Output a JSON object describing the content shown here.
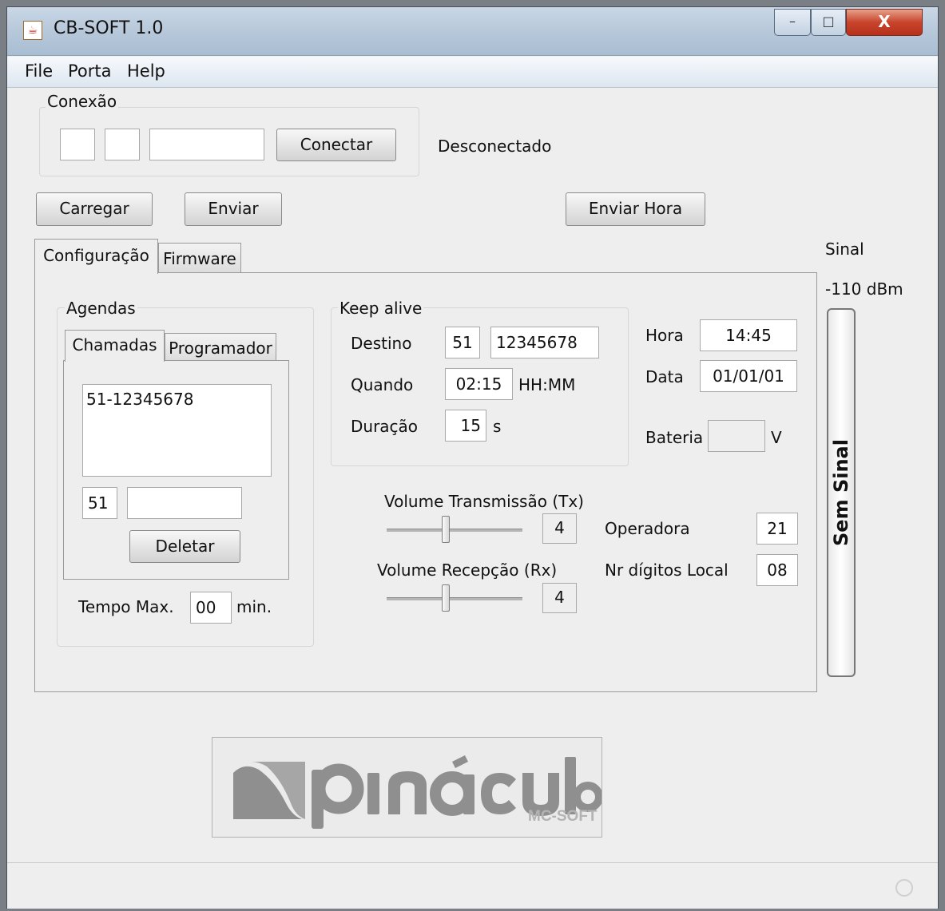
{
  "window": {
    "title": "CB-SOFT 1.0",
    "minimize": "–",
    "maximize": "□",
    "close": "X"
  },
  "menu": {
    "file": "File",
    "porta": "Porta",
    "help": "Help"
  },
  "conexao": {
    "label": "Conexão",
    "field1": "",
    "field2": "",
    "field3": "",
    "connect_button": "Conectar",
    "status": "Desconectado"
  },
  "toolbar": {
    "carregar": "Carregar",
    "enviar": "Enviar",
    "enviar_hora": "Enviar Hora"
  },
  "tabs": {
    "configuracao": "Configuração",
    "firmware": "Firmware"
  },
  "agendas": {
    "label": "Agendas",
    "tab_chamadas": "Chamadas",
    "tab_programador": "Programador",
    "list_items": [
      "51-12345678"
    ],
    "ddd": "51",
    "number": "",
    "delete_button": "Deletar",
    "tempo_max_label": "Tempo Max.",
    "tempo_max_value": "00",
    "tempo_max_unit": "min."
  },
  "keep_alive": {
    "label": "Keep alive",
    "destino_label": "Destino",
    "destino_ddd": "51",
    "destino_number": "12345678",
    "quando_label": "Quando",
    "quando_value": "02:15",
    "quando_unit": "HH:MM",
    "duracao_label": "Duração",
    "duracao_value": "15",
    "duracao_unit": "s"
  },
  "clock": {
    "hora_label": "Hora",
    "hora_value": "14:45",
    "data_label": "Data",
    "data_value": "01/01/01",
    "bateria_label": "Bateria",
    "bateria_value": "",
    "bateria_unit": "V"
  },
  "volume": {
    "tx_label": "Volume Transmissão (Tx)",
    "tx_value": "4",
    "rx_label": "Volume Recepção (Rx)",
    "rx_value": "4"
  },
  "operadora": {
    "label": "Operadora",
    "value": "21",
    "digitos_label": "Nr dígitos Local",
    "digitos_value": "08"
  },
  "signal": {
    "label": "Sinal",
    "dbm": "-110 dBm",
    "status": "Sem Sinal"
  },
  "logo": {
    "brand": "pinaculo",
    "sub": "MC-SOFT"
  },
  "colors": {
    "logo_grey": "#8f8f8f",
    "titlebar": "#b7c8da",
    "close_red": "#c8442b"
  }
}
